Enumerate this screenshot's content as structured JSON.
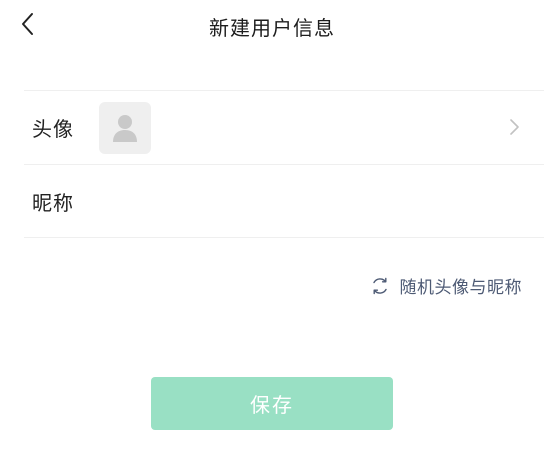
{
  "header": {
    "title": "新建用户信息",
    "back_icon": "chevron-left-icon"
  },
  "form": {
    "avatar_label": "头像",
    "avatar_icon": "user-placeholder-icon",
    "avatar_chevron_icon": "chevron-right-icon",
    "nickname_label": "昵称"
  },
  "random_link": {
    "label": "随机头像与昵称",
    "icon": "refresh-icon"
  },
  "save_button": {
    "label": "保存",
    "color": "#99e0c4"
  },
  "colors": {
    "link": "#4d5a74",
    "divider": "#efefef"
  }
}
